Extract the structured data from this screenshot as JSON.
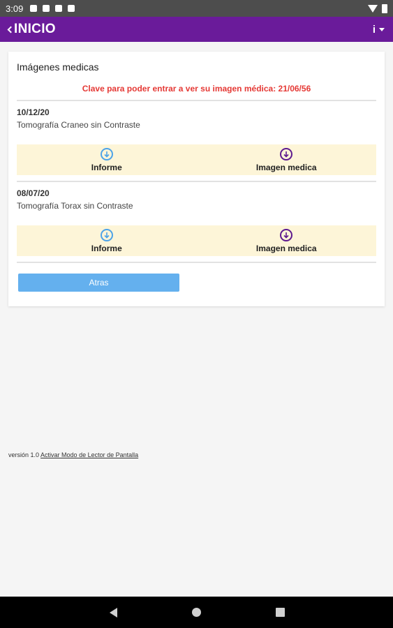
{
  "status_bar": {
    "time": "3:09",
    "icons": [
      "notification-icon",
      "notification-icon",
      "notification-icon",
      "sd-card-icon"
    ],
    "right_icons": [
      "wifi-icon",
      "battery-icon"
    ]
  },
  "app_bar": {
    "title": "INICIO",
    "menu_icon": "info-icon",
    "menu_glyph": "i",
    "bg_color": "#6a1b9a"
  },
  "card": {
    "title": "Imágenes medicas",
    "clave_text": "Clave para poder entrar a ver su imagen médica: 21/06/56",
    "clave_color": "#e53935"
  },
  "records": [
    {
      "date": "10/12/20",
      "description": "Tomografía Craneo sin Contraste",
      "informe_label": "Informe",
      "imagen_label": "Imagen medica"
    },
    {
      "date": "08/07/20",
      "description": "Tomografía Torax sin Contraste",
      "informe_label": "Informe",
      "imagen_label": "Imagen medica"
    }
  ],
  "actions": {
    "back_label": "Atras"
  },
  "footer": {
    "version": "versión 1.0",
    "reader_link": "Activar Modo de Lector de Pantalla"
  },
  "nav_bar": {
    "icons": [
      "back-icon",
      "home-icon",
      "recents-icon"
    ]
  }
}
